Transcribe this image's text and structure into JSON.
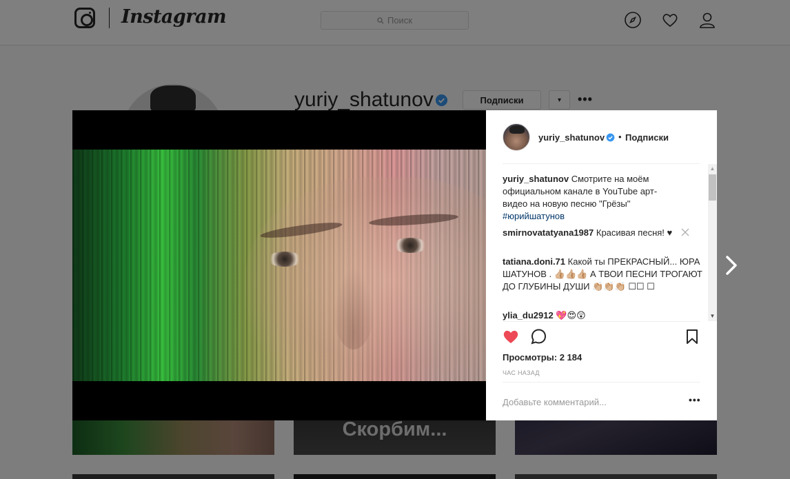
{
  "topbar": {
    "brand": "Instagram",
    "search_placeholder": "Поиск",
    "icons": [
      "instagram-glyph-icon",
      "compass-icon",
      "heart-icon",
      "user-icon"
    ]
  },
  "profile": {
    "username": "yuriy_shatunov",
    "follow_label": "Подписки",
    "dropdown_label": "▾",
    "more_label": "•••"
  },
  "grid": {
    "tile_2_text": "Скорбим..."
  },
  "post": {
    "username": "yuriy_shatunov",
    "separator": "•",
    "follow_label": "Подписки",
    "caption": {
      "user": "yuriy_shatunov",
      "text": "Смотрите на моём официальном канале в YouTube арт-видео на новую песню \"Грёзы\"",
      "hashtag": "#юрийшатунов"
    },
    "comments": [
      {
        "user": "smirnovatatyana1987",
        "text": "Красивая песня! ♥"
      },
      {
        "user": "tatiana.doni.71",
        "text": "Какой ты ПРЕКРАСНЫЙ... ЮРА ШАТУНОВ . 👍🏼👍🏼👍🏼 А ТВОИ ПЕСНИ ТРОГАЮТ ДО ГЛУБИНЫ ДУШИ 👏🏼👏🏼👏🏼 ☐☐ ☐"
      },
      {
        "user": "ylia_du2912",
        "text": "💖😍😲"
      }
    ],
    "views_line": "Просмотры: 2 184",
    "time_ago": "ЧАС НАЗАД",
    "comment_placeholder": "Добавьте комментарий...",
    "more_label": "•••",
    "liked": true,
    "like_color": "#ed4956"
  },
  "colors": {
    "verified": "#3897f0",
    "text": "#262626",
    "muted": "#999999",
    "hashtag": "#003569"
  }
}
